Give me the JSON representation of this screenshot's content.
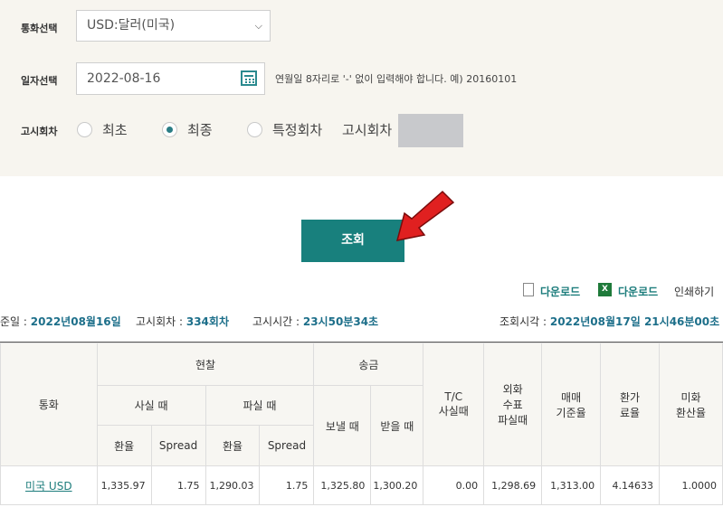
{
  "form": {
    "currency_label": "통화선택",
    "currency_value": "USD:달러(미국)",
    "date_label": "일자선택",
    "date_value": "2022-08-16",
    "date_hint": "연월일 8자리로 '-' 없이 입력해야 합니다. 예) 20160101",
    "round_label": "고시회차",
    "radio_first": "최초",
    "radio_final": "최종",
    "radio_specific": "특정회차",
    "round_input_label": "고시회차",
    "selected_radio": "최종"
  },
  "search_button": "조회",
  "toolbar": {
    "download1": "다운로드",
    "download2": "다운로드",
    "print": "인쇄하기"
  },
  "info": {
    "base_date_label": "준일 :",
    "base_date_value": "2022년08월16일",
    "round_label": "고시회차 :",
    "round_value": "334회차",
    "time_label": "고시시간 :",
    "time_value": "23시50분34초",
    "query_label": "조회시각 :",
    "query_value": "2022년08월17일 21시46분00초"
  },
  "table": {
    "headers": {
      "currency": "통화",
      "cash": "현찰",
      "cash_buy": "사실 때",
      "cash_sell": "파실 때",
      "remit": "송금",
      "remit_send": "보낼 때",
      "remit_receive": "받을 때",
      "tc": "T/C\n사실때",
      "check": "외화\n수표\n파실때",
      "base": "매매\n기준율",
      "conv": "환가\n료율",
      "usd": "미화\n환산율",
      "rate1": "환율",
      "spread1": "Spread",
      "rate2": "환율",
      "spread2": "Spread"
    },
    "rows": [
      {
        "currency": "미국 USD",
        "cash_buy_rate": "1,335.97",
        "cash_buy_spread": "1.75",
        "cash_sell_rate": "1,290.03",
        "cash_sell_spread": "1.75",
        "send": "1,325.80",
        "receive": "1,300.20",
        "tc": "0.00",
        "check": "1,298.69",
        "base": "1,313.00",
        "conv": "4.14633",
        "usd": "1.0000"
      }
    ]
  },
  "colors": {
    "accent": "#18807d",
    "panel_bg": "#f7f5ef",
    "link": "#1d7d7c",
    "arrow": "#e02020"
  }
}
